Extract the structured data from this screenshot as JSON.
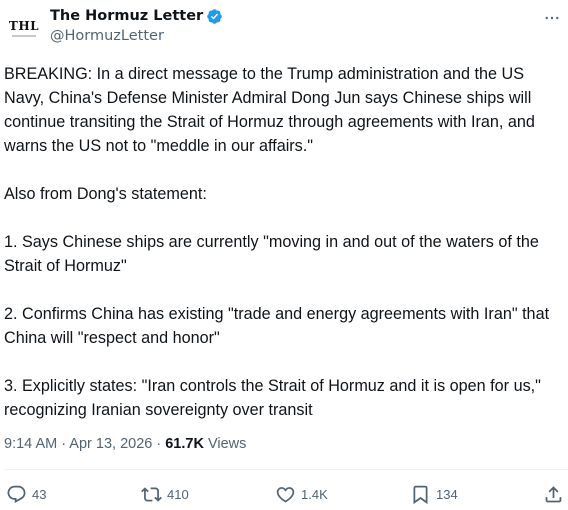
{
  "author": {
    "display_name": "The Hormuz Letter",
    "handle": "@HormuzLetter",
    "avatar_text": "THL",
    "verified": true
  },
  "tweet": {
    "paragraphs": [
      "BREAKING: In a direct message to the Trump administration and the US Navy, China's Defense Minister Admiral Dong Jun says Chinese ships will continue transiting the Strait of Hormuz through agreements with Iran, and warns the US not to \"meddle in our affairs.\"",
      "Also from Dong's statement:",
      "1. Says Chinese ships are currently \"moving in and out of the waters of the Strait of Hormuz\"",
      "2. Confirms China has existing \"trade and energy agreements with Iran\" that China will \"respect and honor\"",
      "3. Explicitly states: \"Iran controls the Strait of Hormuz and it is open for us,\" recognizing Iranian sovereignty over transit"
    ],
    "time": "9:14 AM",
    "separator": " · ",
    "date": "Apr 13, 2026",
    "views_count": "61.7K",
    "views_label": " Views"
  },
  "actions": {
    "replies": "43",
    "reposts": "410",
    "likes": "1.4K",
    "bookmarks": "134"
  },
  "colors": {
    "verified_blue": "#1d9bf0",
    "secondary_text": "#536471",
    "primary_text": "#0f1419"
  }
}
